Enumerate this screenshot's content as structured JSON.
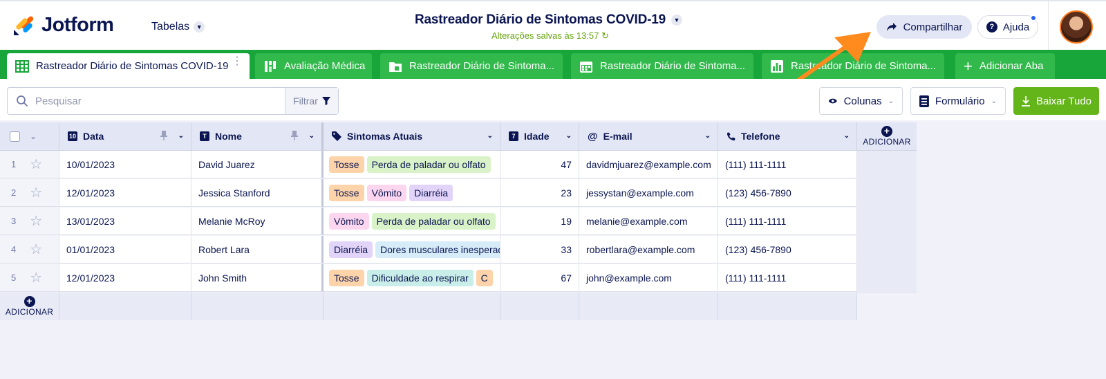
{
  "app": {
    "logo_text": "Jotform",
    "tables_menu_label": "Tabelas",
    "title": "Rastreador Diário de Sintomas COVID-19",
    "saved_status": "Alterações salvas às 13:57",
    "share_label": "Compartilhar",
    "help_label": "Ajuda"
  },
  "tabs": [
    {
      "label": "Rastreador Diário de Sintomas COVID-19",
      "icon": "table-grid-icon",
      "active": true
    },
    {
      "label": "Avaliação Médica",
      "icon": "kanban-icon",
      "active": false
    },
    {
      "label": "Rastreador Diário de Sintoma...",
      "icon": "folder-icon",
      "active": false
    },
    {
      "label": "Rastreador Diário de Sintoma...",
      "icon": "calendar-icon",
      "active": false
    },
    {
      "label": "Rastreador Diário de Sintoma...",
      "icon": "chart-icon",
      "active": false
    },
    {
      "label": "Adicionar Aba",
      "icon": "plus-icon",
      "active": false
    }
  ],
  "toolbar": {
    "search_placeholder": "Pesquisar",
    "filter_label": "Filtrar",
    "columns_label": "Colunas",
    "form_label": "Formulário",
    "download_label": "Baixar Tudo"
  },
  "table": {
    "columns": [
      {
        "label": "Data",
        "type_icon": "calendar-icon"
      },
      {
        "label": "Nome",
        "type_icon": "text-icon"
      },
      {
        "label": "Sintomas Atuais",
        "type_icon": "tag-icon"
      },
      {
        "label": "Idade",
        "type_icon": "number-icon"
      },
      {
        "label": "E-mail",
        "type_icon": "at-icon"
      },
      {
        "label": "Telefone",
        "type_icon": "phone-icon"
      }
    ],
    "add_column_label": "ADICIONAR",
    "add_row_label": "ADICIONAR",
    "rows": [
      {
        "index": "1",
        "date": "10/01/2023",
        "name": "David Juarez",
        "symptoms": [
          "Tosse",
          "Perda de paladar ou olfato"
        ],
        "age": "47",
        "email": "davidmjuarez@example.com",
        "phone": "(111) 111-1111"
      },
      {
        "index": "2",
        "date": "12/01/2023",
        "name": "Jessica Stanford",
        "symptoms": [
          "Tosse",
          "Vômito",
          "Diarréia"
        ],
        "age": "23",
        "email": "jessystan@example.com",
        "phone": "(123) 456-7890"
      },
      {
        "index": "3",
        "date": "13/01/2023",
        "name": "Melanie McRoy",
        "symptoms": [
          "Vômito",
          "Perda de paladar ou olfato"
        ],
        "age": "19",
        "email": "melanie@example.com",
        "phone": "(111) 111-1111"
      },
      {
        "index": "4",
        "date": "01/01/2023",
        "name": "Robert Lara",
        "symptoms": [
          "Diarréia",
          "Dores musculares inesperadas"
        ],
        "age": "33",
        "email": "robertlara@example.com",
        "phone": "(123) 456-7890"
      },
      {
        "index": "5",
        "date": "12/01/2023",
        "name": "John Smith",
        "symptoms": [
          "Tosse",
          "Dificuldade ao respirar",
          "C"
        ],
        "age": "67",
        "email": "john@example.com",
        "phone": "(111) 111-1111"
      }
    ]
  },
  "colors": {
    "tab_bar": "#18a53a",
    "tab": "#31b94b",
    "download_button": "#64b51a",
    "annotation_arrow": "#ff8a1e",
    "tag_tosse": "#fdd3a9",
    "tag_vomito": "#fbd6ee",
    "tag_diarreia": "#e2d3f8",
    "tag_paladar": "#d9f2c8",
    "tag_dores": "#d6ecf8",
    "tag_respirar": "#c9ede8"
  }
}
